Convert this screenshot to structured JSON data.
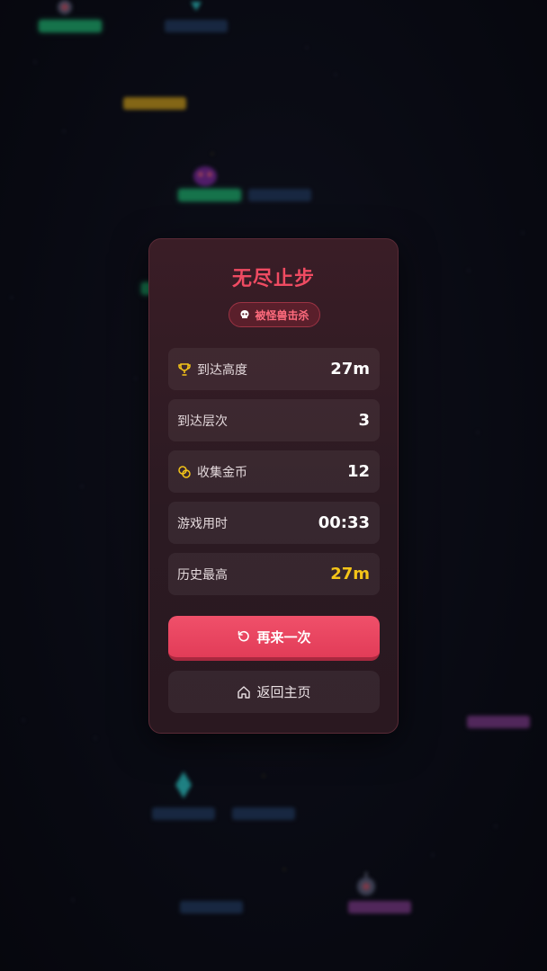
{
  "gameover": {
    "title": "无尽止步",
    "cause": "被怪兽击杀",
    "stats": [
      {
        "label": "到达高度",
        "value": "27m",
        "icon": "trophy-icon"
      },
      {
        "label": "到达层次",
        "value": "3",
        "icon": ""
      },
      {
        "label": "收集金币",
        "value": "12",
        "icon": "coins-icon"
      },
      {
        "label": "游戏用时",
        "value": "00:33",
        "icon": ""
      },
      {
        "label": "历史最高",
        "value": "27m",
        "icon": "",
        "highlight": "#f5c518"
      }
    ],
    "retry_label": "再来一次",
    "home_label": "返回主页"
  },
  "colors": {
    "accent": "#ef4b62",
    "panel": "#2b1a22",
    "gold": "#f5c518"
  }
}
